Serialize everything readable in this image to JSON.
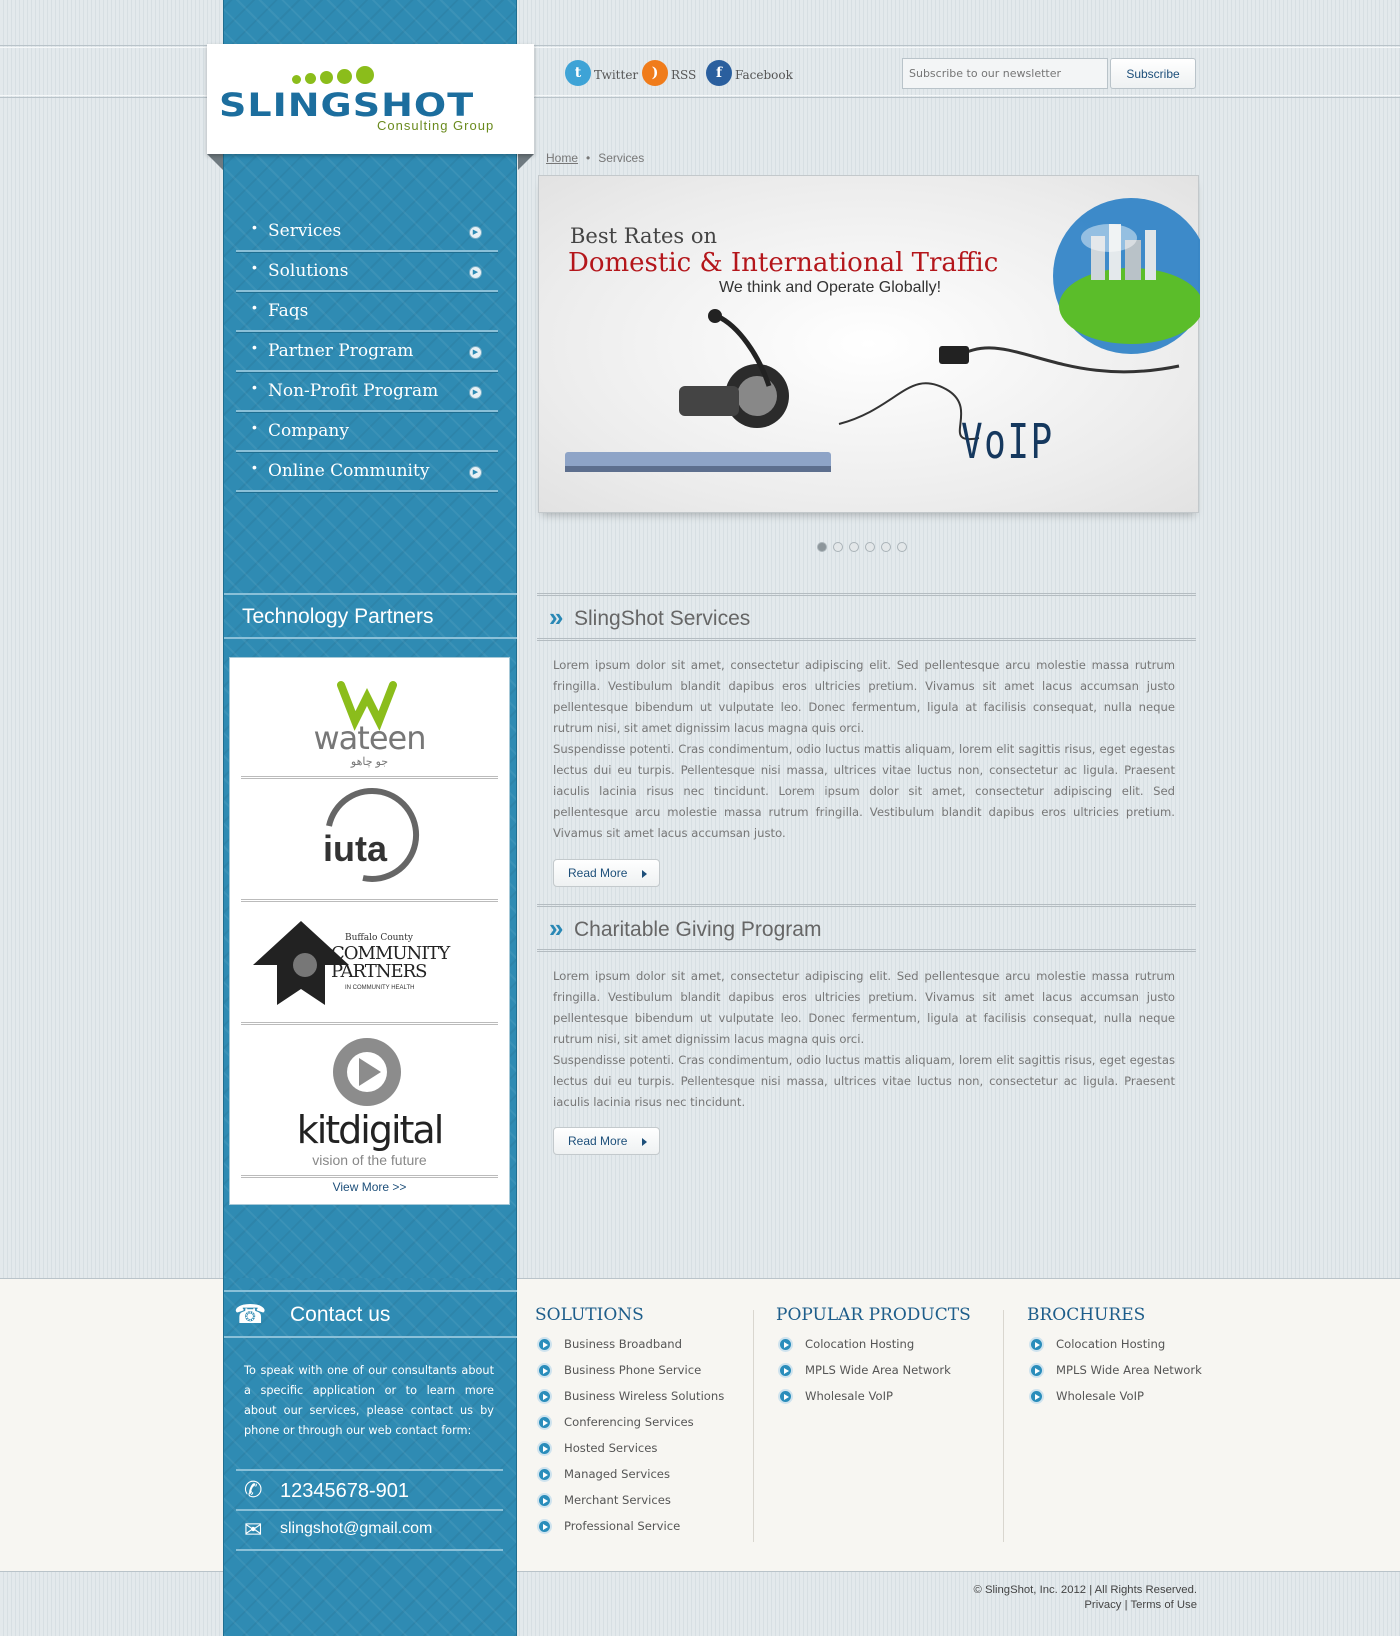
{
  "brand": {
    "name": "SLINGSHOT",
    "subtitle": "Consulting Group"
  },
  "social": [
    {
      "label": "Twitter",
      "icon": "twitter-icon",
      "glyph": "t",
      "color": "#3ea3d6"
    },
    {
      "label": "RSS",
      "icon": "rss-icon",
      "glyph": ")",
      "color": "#f07c1b"
    },
    {
      "label": "Facebook",
      "icon": "facebook-icon",
      "glyph": "f",
      "color": "#2a5f9e"
    }
  ],
  "newsletter": {
    "placeholder": "Subscribe to our newsletter",
    "button": "Subscribe"
  },
  "breadcrumb": {
    "home": "Home",
    "separator": "•",
    "current": "Services"
  },
  "nav": [
    {
      "label": "Services",
      "has_arrow": true
    },
    {
      "label": "Solutions",
      "has_arrow": true
    },
    {
      "label": "Faqs",
      "has_arrow": false
    },
    {
      "label": "Partner Program",
      "has_arrow": true
    },
    {
      "label": "Non-Profit Program",
      "has_arrow": true
    },
    {
      "label": "Company",
      "has_arrow": false
    },
    {
      "label": "Online Community",
      "has_arrow": true
    }
  ],
  "banner": {
    "line1": "Best Rates on",
    "line2": "Domestic & International Traffic",
    "line3": "We think and Operate Globally!",
    "product": "VoIP",
    "slides": 6,
    "active_slide": 1
  },
  "tech_partners": {
    "title": "Technology Partners",
    "partners": [
      {
        "name": "wateen",
        "tagline": "جو چاهو"
      },
      {
        "name": "iuta"
      },
      {
        "name": "COMMUNITY PARTNERS",
        "tagline": "Buffalo County",
        "sub": "IN COMMUNITY HEALTH"
      },
      {
        "name": "kitdigital",
        "tagline": "vision of the future"
      }
    ],
    "view_more": "View More >>"
  },
  "sections": [
    {
      "title": "SlingShot Services",
      "paragraphs": [
        "Lorem ipsum dolor sit amet, consectetur adipiscing elit. Sed pellentesque arcu molestie massa rutrum fringilla. Vestibulum blandit dapibus eros ultricies pretium. Vivamus sit amet lacus accumsan justo pellentesque bibendum ut vulputate leo. Donec fermentum, ligula at facilisis consequat, nulla neque rutrum nisi, sit amet dignissim lacus magna quis orci.",
        "Suspendisse potenti. Cras condimentum, odio luctus mattis aliquam, lorem elit sagittis risus, eget egestas lectus dui eu turpis. Pellentesque nisi massa, ultrices vitae luctus non, consectetur ac ligula. Praesent iaculis lacinia risus nec tincidunt. Lorem ipsum dolor sit amet, consectetur adipiscing elit. Sed pellentesque arcu molestie massa rutrum fringilla. Vestibulum blandit dapibus eros ultricies pretium. Vivamus sit amet lacus accumsan justo."
      ],
      "read_more": "Read More"
    },
    {
      "title": "Charitable Giving Program",
      "paragraphs": [
        "Lorem ipsum dolor sit amet, consectetur adipiscing elit. Sed pellentesque arcu molestie massa rutrum fringilla. Vestibulum blandit dapibus eros ultricies pretium. Vivamus sit amet lacus accumsan justo pellentesque bibendum ut vulputate leo. Donec fermentum, ligula at facilisis consequat, nulla neque rutrum nisi, sit amet dignissim lacus magna quis orci.",
        "Suspendisse potenti. Cras condimentum, odio luctus mattis aliquam, lorem elit sagittis risus, eget egestas lectus dui eu turpis. Pellentesque nisi massa, ultrices vitae luctus non, consectetur ac ligula. Praesent iaculis lacinia risus nec tincidunt."
      ],
      "read_more": "Read More"
    }
  ],
  "contact": {
    "title": "Contact us",
    "text": "To speak with one of our consultants about a specific application or to learn more about our services, please contact us by phone or through our web contact form:",
    "phone": "12345678-901",
    "email": "slingshot@gmail.com"
  },
  "footer_columns": [
    {
      "title": "SOLUTIONS",
      "items": [
        "Business Broadband",
        "Business Phone Service",
        "Business Wireless Solutions",
        "Conferencing Services",
        "Hosted Services",
        "Managed Services",
        "Merchant Services",
        "Professional Service"
      ]
    },
    {
      "title": "POPULAR PRODUCTS",
      "items": [
        "Colocation Hosting",
        "MPLS Wide Area Network",
        "Wholesale VoIP"
      ]
    },
    {
      "title": "BROCHURES",
      "items": [
        "Colocation Hosting",
        "MPLS Wide Area Network",
        "Wholesale VoIP"
      ]
    }
  ],
  "copyright": {
    "line1": "© SlingShot, Inc. 2012 | All Rights Reserved.",
    "privacy": "Privacy",
    "sep": " | ",
    "terms": "Terms of Use"
  }
}
